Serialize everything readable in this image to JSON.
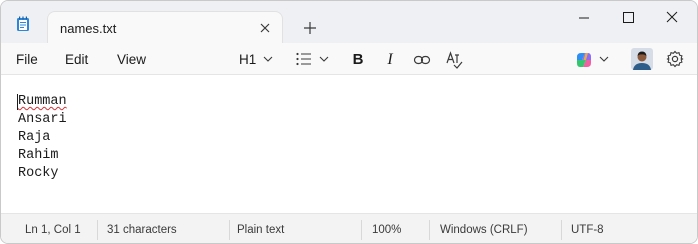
{
  "tab": {
    "title": "names.txt"
  },
  "menu": {
    "file": "File",
    "edit": "Edit",
    "view": "View"
  },
  "toolbar": {
    "heading": "H1",
    "bold": "B",
    "italic": "I",
    "icons": [
      "list-icon",
      "link-icon",
      "spellcheck-icon",
      "copilot-icon",
      "settings-icon"
    ]
  },
  "document": {
    "lines": [
      "Rumman",
      "Ansari",
      "Raja",
      "Rahim",
      "Rocky"
    ]
  },
  "status": {
    "position": "Ln 1, Col 1",
    "characters": "31 characters",
    "format": "Plain text",
    "zoom": "100%",
    "line_endings": "Windows (CRLF)",
    "encoding": "UTF-8"
  },
  "colors": {
    "titlebar": "#eef0f3",
    "toolbar": "#f9f9f9",
    "statusbar": "#f3f3f3",
    "spell_error": "#d13438"
  }
}
